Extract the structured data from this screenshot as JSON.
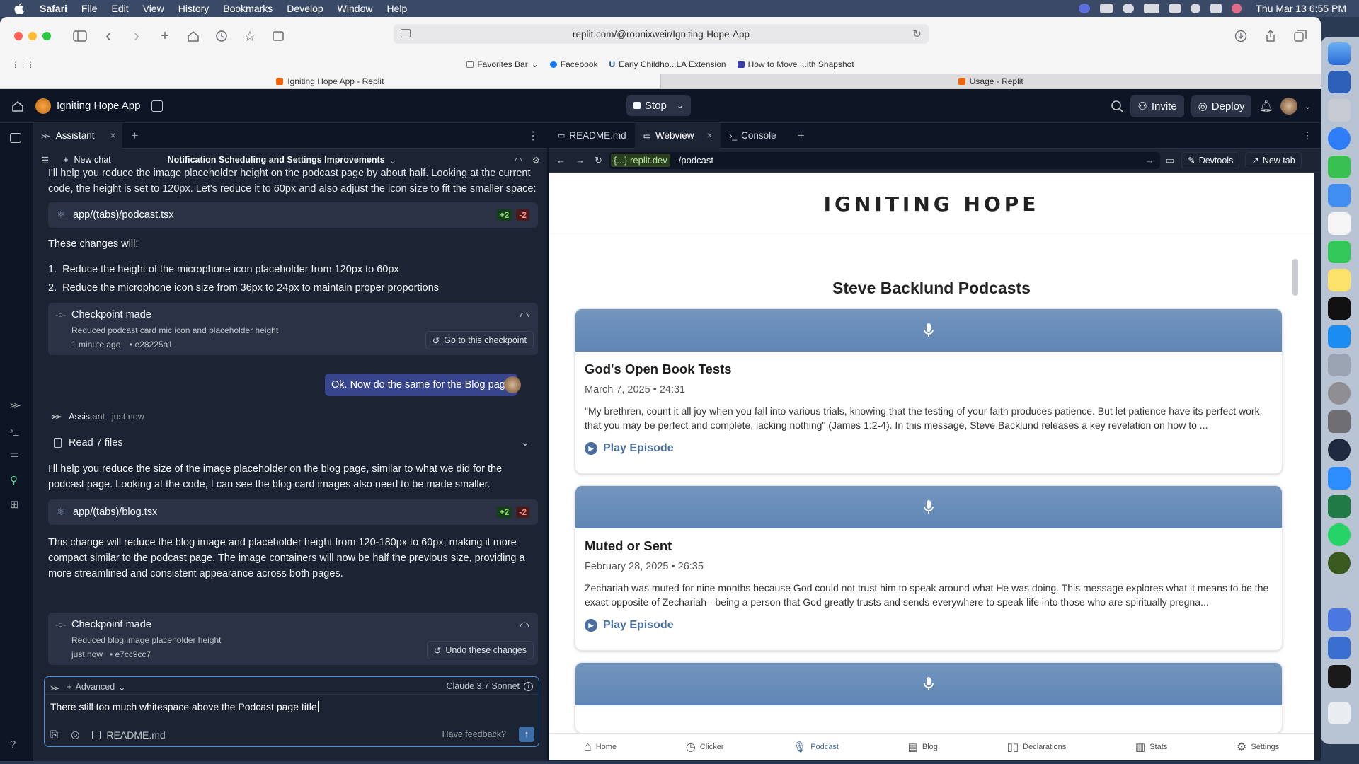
{
  "menubar": {
    "app": "Safari",
    "items": [
      "File",
      "Edit",
      "View",
      "History",
      "Bookmarks",
      "Develop",
      "Window",
      "Help"
    ],
    "datetime": "Thu Mar 13  6:55 PM"
  },
  "safari": {
    "url": "replit.com/@robnixweir/Igniting-Hope-App",
    "favorites": [
      "Favorites Bar",
      "Facebook",
      "Early Childho...LA Extension",
      "How to Move ...ith Snapshot"
    ],
    "tabs": [
      {
        "title": "Igniting Hope App - Replit"
      },
      {
        "title": "Usage - Replit"
      }
    ]
  },
  "replit": {
    "project_name": "Igniting Hope App",
    "stop_label": "Stop",
    "invite_label": "Invite",
    "deploy_label": "Deploy",
    "assistant_tab": "Assistant",
    "new_chat": "New chat",
    "chat_title": "Notification Scheduling and Settings Improvements",
    "messages": {
      "intro": "I'll help you reduce the image placeholder height on the podcast page by about half. Looking at the current code, the height is set to 120px. Let's reduce it to 60px and also adjust the icon size to fit the smaller space:",
      "file1": "app/(tabs)/podcast.tsx",
      "plus1": "+2",
      "minus1": "-2",
      "changes_heading": "These changes will:",
      "change1": "Reduce the height of the microphone icon placeholder from 120px to 60px",
      "change2": "Reduce the microphone icon size from 36px to 24px to maintain proper proportions",
      "ckpt1_title": "Checkpoint made",
      "ckpt1_desc": "Reduced podcast card mic icon and placeholder height",
      "ckpt1_time": "1 minute ago",
      "ckpt1_hash": "• e28225a1",
      "ckpt1_btn": "Go to this checkpoint",
      "user_msg": "Ok. Now do the same for the Blog page",
      "assistant_name": "Assistant",
      "assistant_time": "just now",
      "read_files": "Read 7 files",
      "reply1": "I'll help you reduce the size of the image placeholder on the blog page, similar to what we did for the podcast page. Looking at the code, I can see the blog card images also need to be made smaller.",
      "file2": "app/(tabs)/blog.tsx",
      "plus2": "+2",
      "minus2": "-2",
      "reply2": "This change will reduce the blog image and placeholder height from 120-180px to 60px, making it more compact similar to the podcast page. The image containers will now be half the previous size, providing a more streamlined and consistent appearance across both pages.",
      "ckpt2_title": "Checkpoint made",
      "ckpt2_desc": "Reduced blog image placeholder height",
      "ckpt2_time": "just now",
      "ckpt2_hash": "• e7cc9cc7",
      "ckpt2_btn": "Undo these changes"
    },
    "input": {
      "advanced": "Advanced",
      "model": "Claude 3.7 Sonnet",
      "text": "There still too much whitespace above the Podcast page title",
      "attachment": "README.md",
      "feedback": "Have feedback?"
    },
    "workspace_tabs": [
      "README.md",
      "Webview",
      "Console"
    ],
    "webview_domain": "{...}.replit.dev",
    "webview_path": "/podcast",
    "devtools": "Devtools",
    "newtab": "New tab"
  },
  "app": {
    "logo": "IGNITING HOPE",
    "page_title": "Steve Backlund Podcasts",
    "episodes": [
      {
        "title": "God's Open Book Tests",
        "date": "March 7, 2025",
        "duration": "• 24:31",
        "description": "\"My brethren, count it all joy when you fall into various trials, knowing that the testing of your faith produces patience. But let patience have its perfect work, that you may be perfect and complete, lacking nothing\" (James 1:2-4). In this message, Steve Backlund releases a key revelation on how to ...",
        "play": "Play Episode"
      },
      {
        "title": "Muted or Sent",
        "date": "February 28, 2025",
        "duration": "• 26:35",
        "description": "Zechariah was muted for nine months because God could not trust him to speak around what He was doing. This message explores what it means to be the exact opposite of Zechariah - being a person that God greatly trusts and sends everywhere to speak life into those who are spiritually pregna...",
        "play": "Play Episode"
      }
    ],
    "nav": [
      "Home",
      "Clicker",
      "Podcast",
      "Blog",
      "Declarations",
      "Stats",
      "Settings"
    ],
    "accent": "#4a6f9f"
  }
}
